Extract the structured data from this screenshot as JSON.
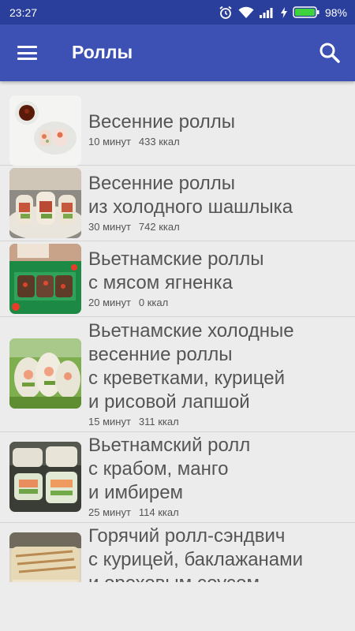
{
  "status_bar": {
    "time": "23:27",
    "battery": "98%"
  },
  "app_bar": {
    "title": "Роллы"
  },
  "recipes": [
    {
      "name": [
        "Весенние роллы"
      ],
      "time": "10 минут",
      "kcal": "433 ккал"
    },
    {
      "name": [
        "Весенние роллы",
        "из холодного шашлыка"
      ],
      "time": "30 минут",
      "kcal": "742 ккал"
    },
    {
      "name": [
        "Вьетнамские роллы",
        "с мясом ягненка"
      ],
      "time": "20 минут",
      "kcal": "0 ккал"
    },
    {
      "name": [
        "Вьетнамские холодные",
        "весенние роллы",
        "с креветками, курицей",
        "и рисовой лапшой"
      ],
      "time": "15 минут",
      "kcal": "311 ккал"
    },
    {
      "name": [
        "Вьетнамский ролл",
        "с крабом, манго",
        "и имбирем"
      ],
      "time": "25 минут",
      "kcal": "114 ккал"
    },
    {
      "name": [
        "Горячий ролл-сэндвич",
        "с курицей, баклажанами",
        "и ореховым соусом"
      ],
      "time": "",
      "kcal": ""
    }
  ]
}
